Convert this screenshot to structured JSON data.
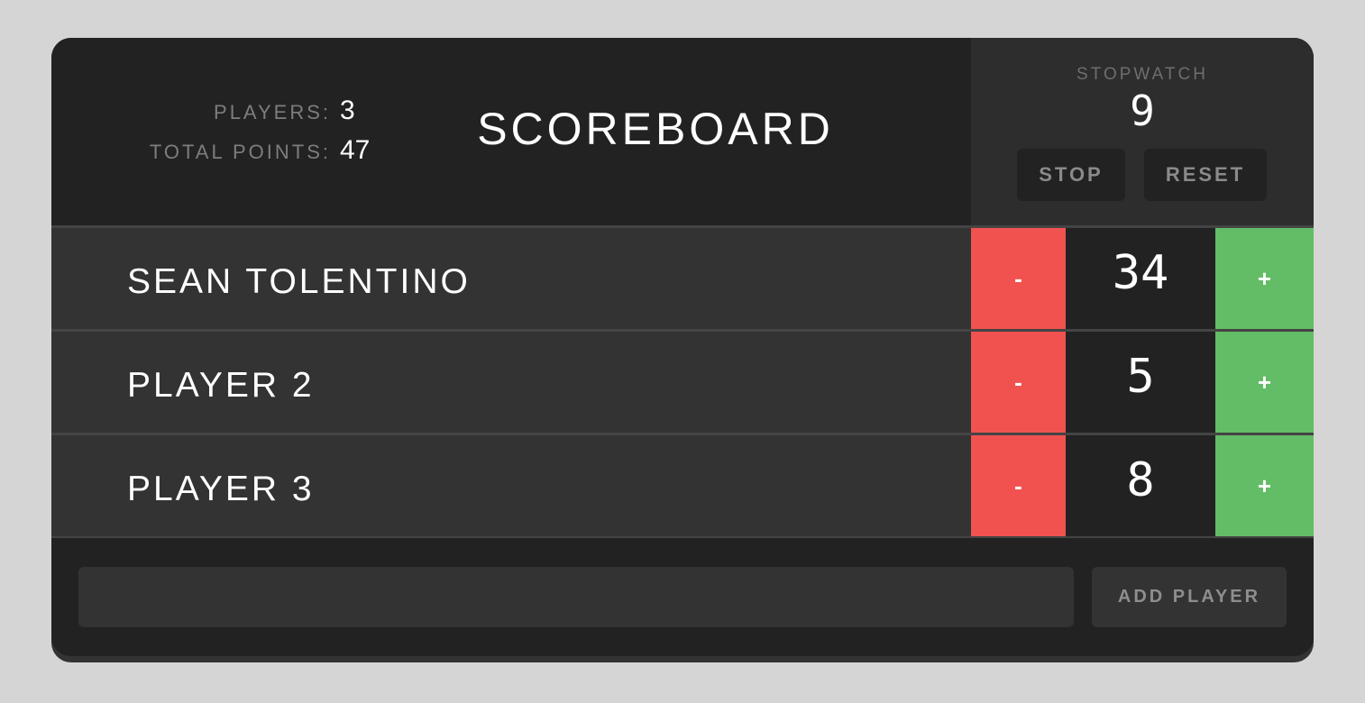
{
  "header": {
    "title": "SCOREBOARD",
    "stats": {
      "players_label": "PLAYERS:",
      "players_value": "3",
      "total_points_label": "TOTAL POINTS:",
      "total_points_value": "47"
    },
    "stopwatch": {
      "label": "STOPWATCH",
      "value": "9",
      "stop_label": "STOP",
      "reset_label": "RESET"
    }
  },
  "players": [
    {
      "name": "SEAN TOLENTINO",
      "score": "34",
      "minus_label": "-",
      "plus_label": "+"
    },
    {
      "name": "PLAYER 2",
      "score": "5",
      "minus_label": "-",
      "plus_label": "+"
    },
    {
      "name": "PLAYER 3",
      "score": "8",
      "minus_label": "-",
      "plus_label": "+"
    }
  ],
  "footer": {
    "input_value": "",
    "input_placeholder": "",
    "add_player_label": "ADD PLAYER"
  },
  "colors": {
    "board_bg": "#222222",
    "row_bg": "#333333",
    "minus_red": "#f1524f",
    "plus_green": "#62bd66",
    "page_bg": "#d5d5d5"
  }
}
